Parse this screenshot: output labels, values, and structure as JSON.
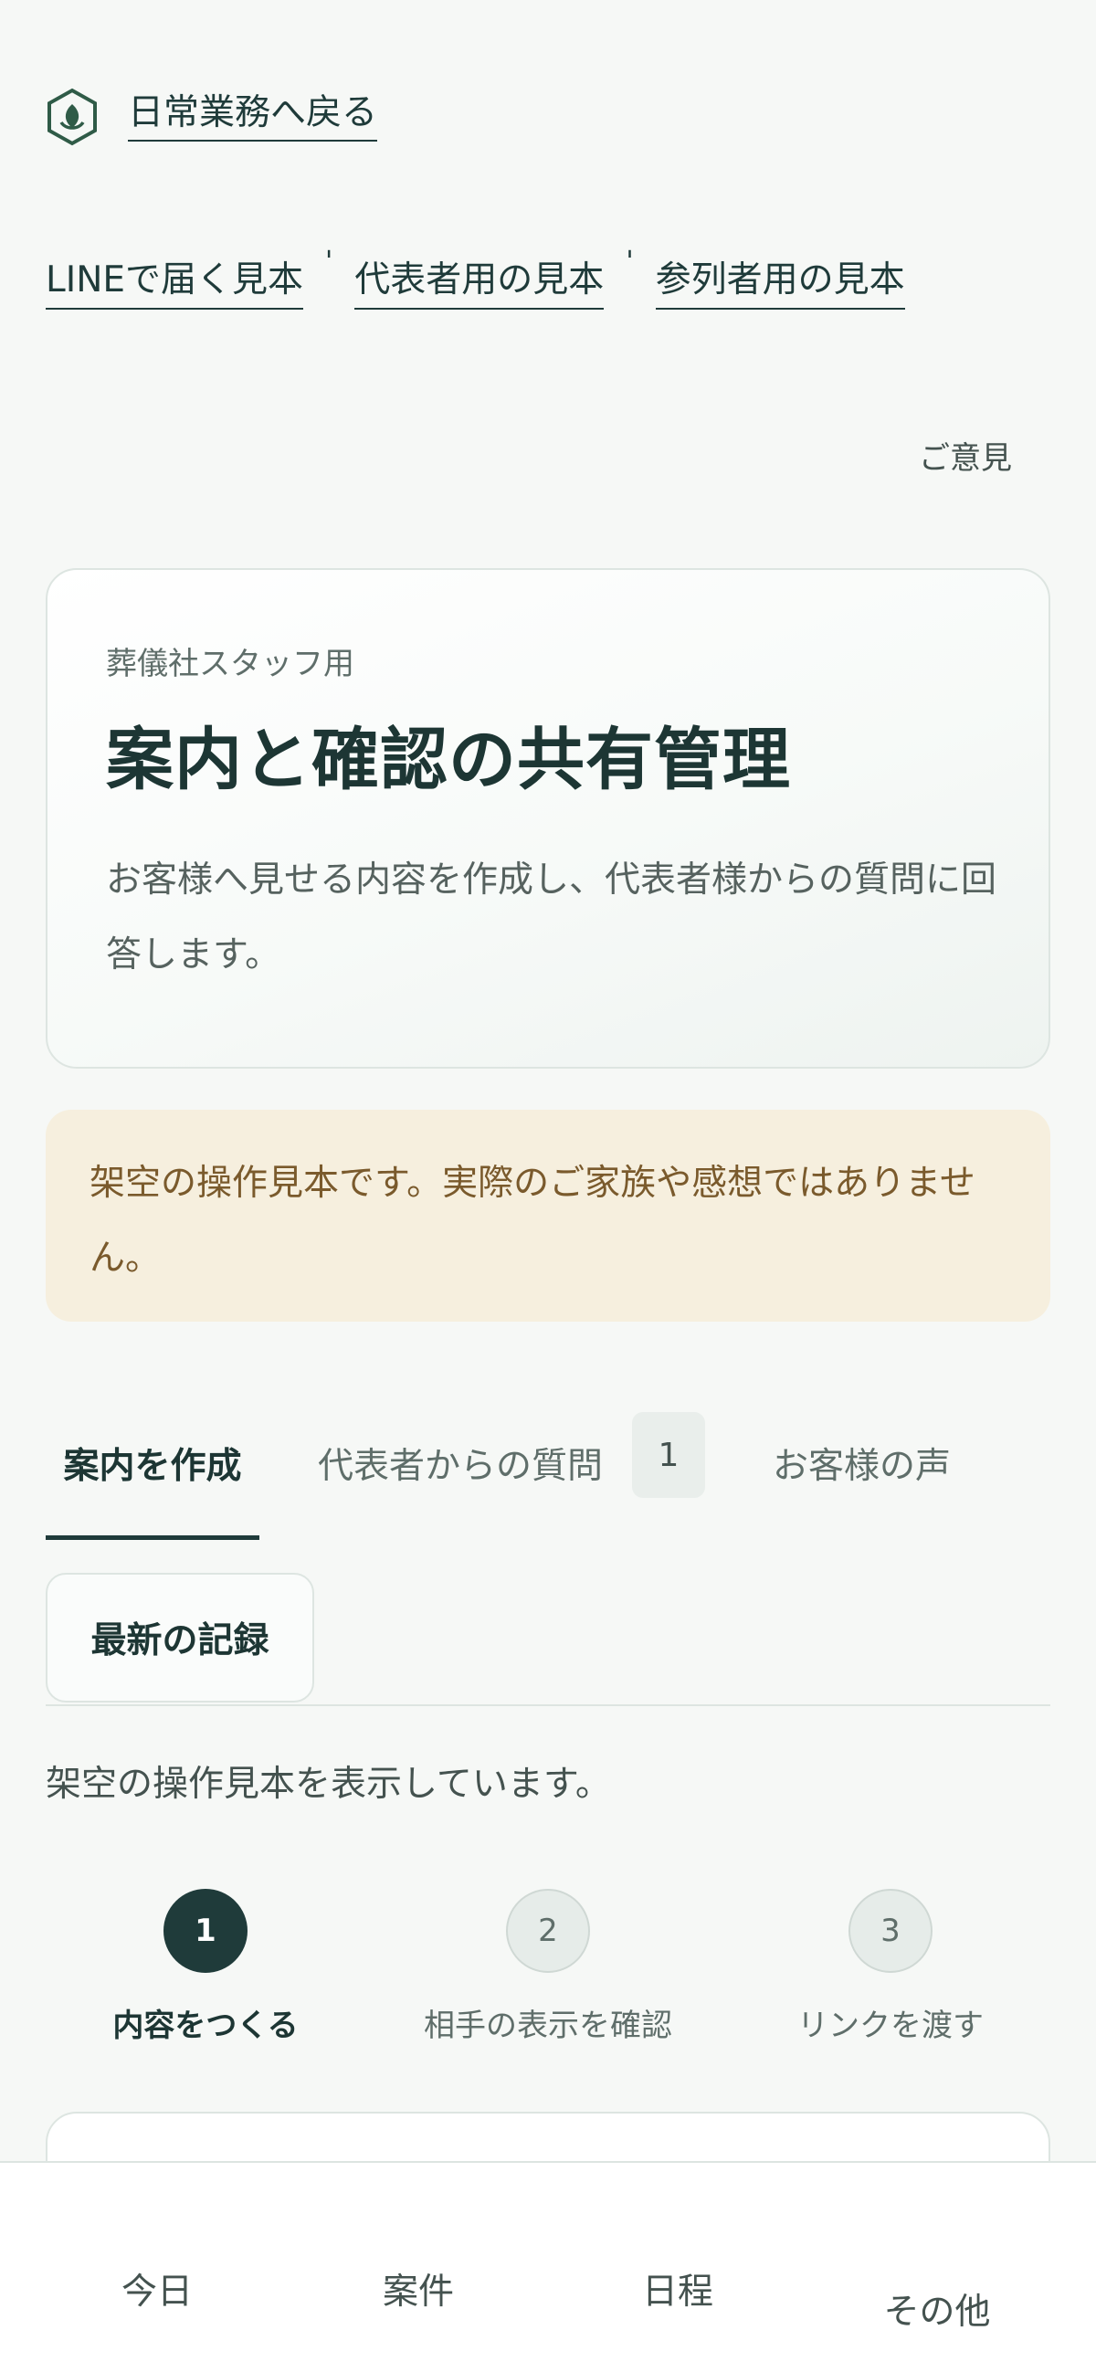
{
  "back": {
    "label": "日常業務へ戻る",
    "icon": "leaf-shield-icon"
  },
  "sample_links": [
    {
      "label": "LINEで届く見本"
    },
    {
      "label": "代表者用の見本"
    },
    {
      "label": "参列者用の見本"
    }
  ],
  "sample_separator": "'",
  "feedback_label": "ご意見",
  "hero": {
    "eyebrow": "葬儀社スタッフ用",
    "title": "案内と確認の共有管理",
    "description": "お客様へ見せる内容を作成し、代表者様からの質問に回答します。"
  },
  "notice": {
    "text": "架空の操作見本です。実際のご家族や感想ではありません。"
  },
  "tabs": {
    "create": "案内を作成",
    "questions": "代表者からの質問",
    "questions_badge": "1",
    "voice": "お客様の声",
    "latest": "最新の記録"
  },
  "showing_text": "架空の操作見本を表示しています。",
  "steps": [
    {
      "number": "1",
      "label": "内容をつくる"
    },
    {
      "number": "2",
      "label": "相手の表示を確認"
    },
    {
      "number": "3",
      "label": "リンクを渡す"
    }
  ],
  "bottom_nav": {
    "today": "今日",
    "cases": "案件",
    "schedule": "日程",
    "other": "その他"
  },
  "colors": {
    "primary": "#1f3b3a",
    "background": "#f6f8f6",
    "notice_bg": "#f6efde",
    "notice_text": "#7a5a2c"
  }
}
